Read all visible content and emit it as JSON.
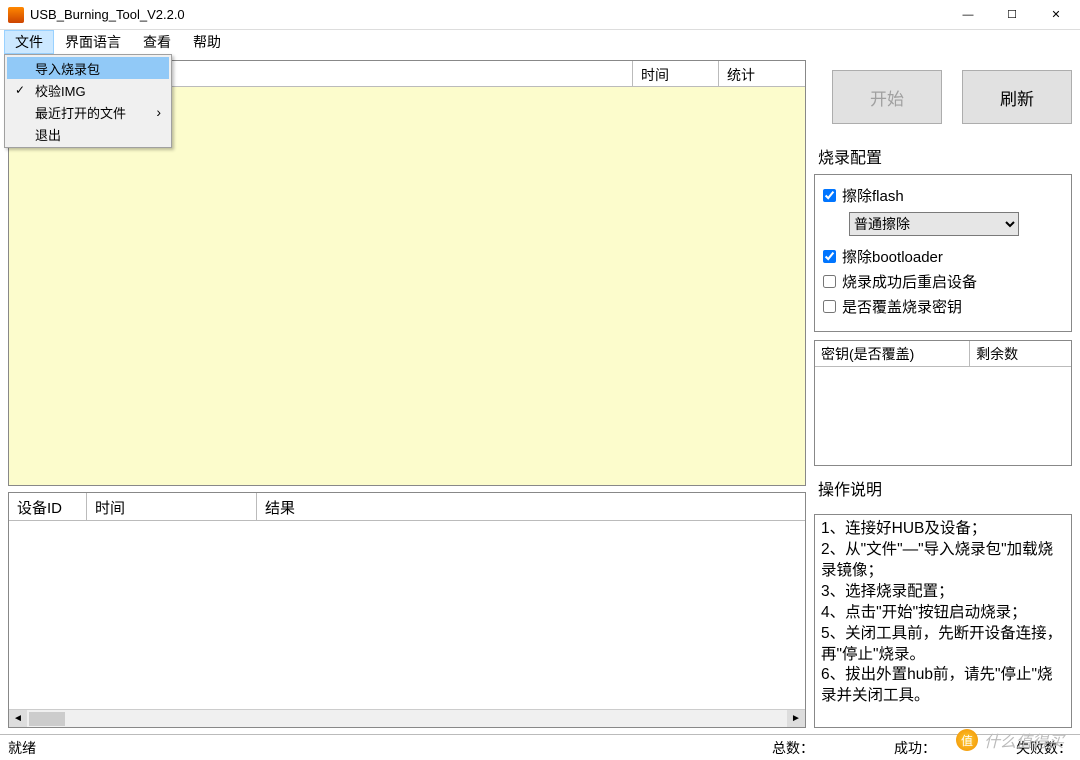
{
  "window": {
    "title": "USB_Burning_Tool_V2.2.0"
  },
  "menubar": {
    "file": "文件",
    "lang": "界面语言",
    "view": "查看",
    "help": "帮助"
  },
  "file_menu": {
    "import": "导入烧录包",
    "verify": "校验IMG",
    "recent": "最近打开的文件",
    "exit": "退出"
  },
  "top_table": {
    "left_col": "",
    "time": "时间",
    "stat": "统计"
  },
  "bottom_table": {
    "device_id": "设备ID",
    "time": "时间",
    "result": "结果"
  },
  "buttons": {
    "start": "开始",
    "refresh": "刷新"
  },
  "config": {
    "title": "烧录配置",
    "erase_flash": "擦除flash",
    "erase_mode": "普通擦除",
    "erase_bootloader": "擦除bootloader",
    "reboot_after": "烧录成功后重启设备",
    "overwrite_key": "是否覆盖烧录密钥"
  },
  "key_table": {
    "col1": "密钥(是否覆盖)",
    "col2": "剩余数"
  },
  "instructions": {
    "title": "操作说明",
    "line1": "1、连接好HUB及设备；",
    "line2": "2、从\"文件\"—\"导入烧录包\"加载烧录镜像；",
    "line3": "3、选择烧录配置；",
    "line4": "4、点击\"开始\"按钮启动烧录；",
    "line5": "5、关闭工具前，先断开设备连接，再\"停止\"烧录。",
    "line6": "6、拔出外置hub前，请先\"停止\"烧录并关闭工具。"
  },
  "status": {
    "ready": "就绪",
    "total": "总数：",
    "success": "成功：",
    "fail": "失败数："
  },
  "watermark": "什么值得买"
}
